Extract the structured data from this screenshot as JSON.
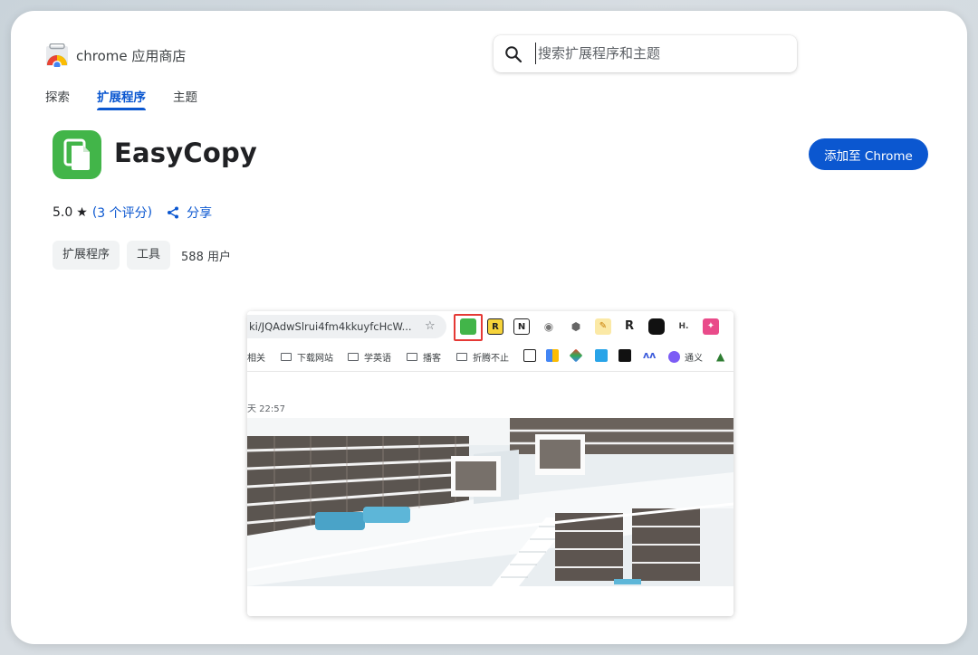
{
  "header": {
    "store_name": "chrome 应用商店",
    "search_placeholder": "搜索扩展程序和主题"
  },
  "nav": {
    "tabs": [
      {
        "label": "探索",
        "active": false
      },
      {
        "label": "扩展程序",
        "active": true
      },
      {
        "label": "主题",
        "active": false
      }
    ]
  },
  "extension": {
    "name": "EasyCopy",
    "add_button_label": "添加至 Chrome",
    "rating": "5.0",
    "rating_star": "★",
    "rating_open": "(",
    "rating_count": "3 个评分",
    "rating_close": ")",
    "share_label": "分享",
    "chips": [
      "扩展程序",
      "工具"
    ],
    "users": "588 用户",
    "icon_color": "#42b549"
  },
  "preview": {
    "url_text": "ki/JQAdwSlrui4fm4kkuyfcHcW...",
    "bookmarks": [
      "相关",
      "下载网站",
      "学英语",
      "播客",
      "折腾不止",
      "通义"
    ],
    "timestamp": "天 22:57"
  },
  "colors": {
    "accent": "#0b57d0",
    "highlight_box": "#e53935"
  }
}
